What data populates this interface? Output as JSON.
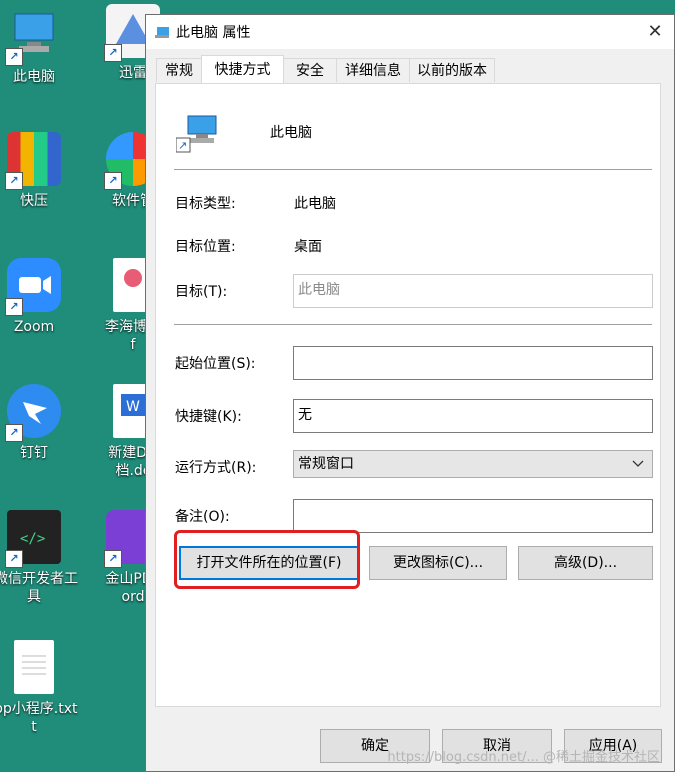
{
  "desktop": {
    "icons": [
      {
        "label": "此电脑"
      },
      {
        "label": "迅雷"
      },
      {
        "label": "快压"
      },
      {
        "label": "软件管"
      },
      {
        "label": "Zoom"
      },
      {
        "label": "李海博（"
      },
      {
        "label": "f"
      },
      {
        "label": "钉钉"
      },
      {
        "label": "新建DO"
      },
      {
        "label": "档.dc"
      },
      {
        "label": "微信开发者工"
      },
      {
        "label": "具"
      },
      {
        "label": "金山PDF"
      },
      {
        "label": "ord"
      },
      {
        "label": "pp小程序.txt"
      },
      {
        "label": "t"
      }
    ]
  },
  "dialog": {
    "title": "此电脑 属性",
    "close_glyph": "✕",
    "tabs": [
      "常规",
      "快捷方式",
      "安全",
      "详细信息",
      "以前的版本"
    ],
    "active_tab": "快捷方式",
    "header_name": "此电脑",
    "target_type_label": "目标类型:",
    "target_type_value": "此电脑",
    "target_location_label": "目标位置:",
    "target_location_value": "桌面",
    "target_label": "目标(T):",
    "target_value": "此电脑",
    "start_in_label": "起始位置(S):",
    "start_in_value": "",
    "shortcut_key_label": "快捷键(K):",
    "shortcut_key_value": "无",
    "run_label": "运行方式(R):",
    "run_value": "常规窗口",
    "comment_label": "备注(O):",
    "comment_value": "",
    "open_location_button": "打开文件所在的位置(F)",
    "change_icon_button": "更改图标(C)...",
    "advanced_button": "高级(D)...",
    "ok_button": "确定",
    "cancel_button": "取消",
    "apply_button": "应用(A)"
  },
  "watermark": "https://blog.csdn.net/...  @稀土掘金技术社区",
  "colors": {
    "desktop_bg": "#1f8d7a",
    "highlight": "#e02020",
    "focus": "#0078d7"
  }
}
